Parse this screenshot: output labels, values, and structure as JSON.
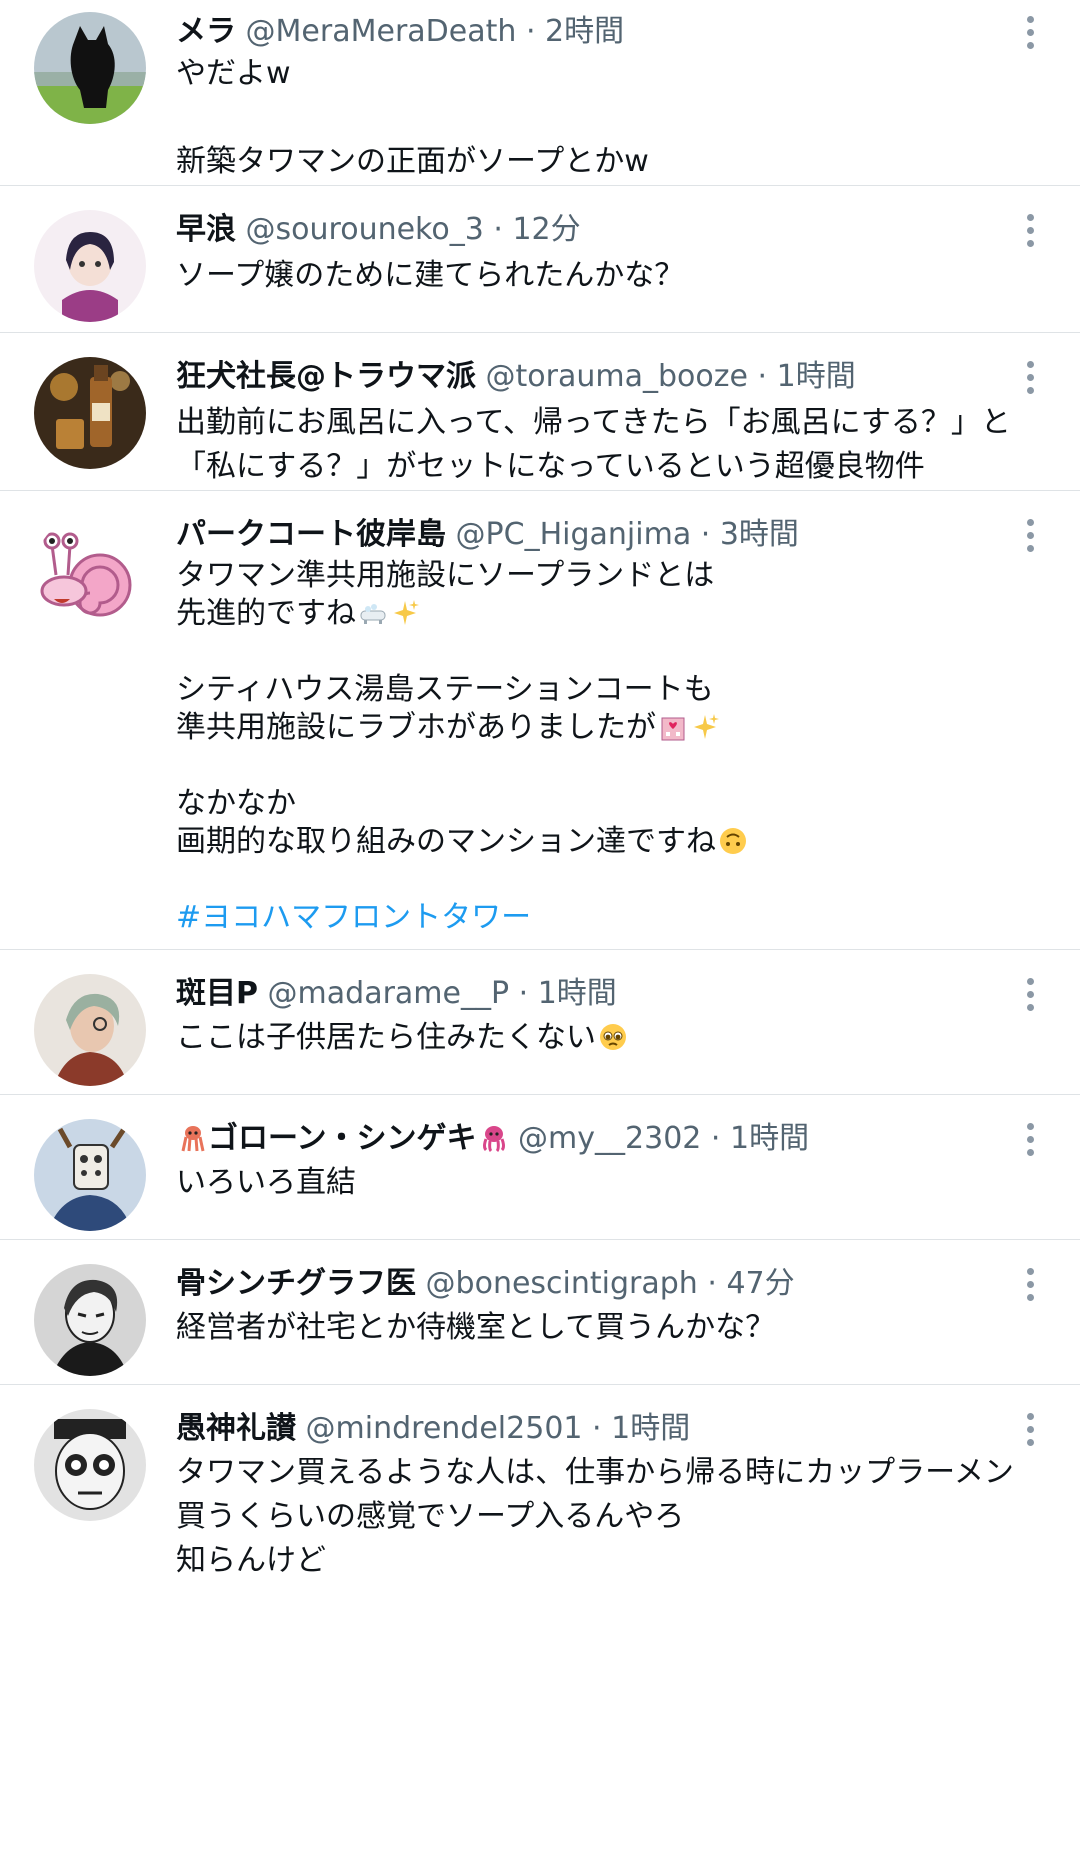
{
  "tweets": [
    {
      "name": "メラ",
      "handle": "@MeraMeraDeath",
      "sep": "·",
      "time": "2時間",
      "lines": [
        "やだよw",
        "",
        "新築タワマンの正面がソープとかw"
      ],
      "avatar_icon": "black-cat-avatar"
    },
    {
      "name": "早浪",
      "handle": "@sourouneko_3",
      "sep": "·",
      "time": "12分",
      "lines": [
        "ソープ嬢のために建てられたんかな？"
      ],
      "avatar_icon": "anime-girl-avatar"
    },
    {
      "name": "狂犬社長@トラウマ派",
      "handle": "@torauma_booze",
      "sep": "·",
      "time": "1時間",
      "lines": [
        "出勤前にお風呂に入って、帰ってきたら「お風呂にする？」と",
        "「私にする？」がセットになっているという超優良物件"
      ],
      "avatar_icon": "whisky-bottle-avatar"
    },
    {
      "name": "パークコート彼岸島",
      "handle": "@PC_Higanjima",
      "sep": "·",
      "time": "3時間",
      "lines": [
        "タワマン準共用施設にソープランドとは",
        "先進的ですね",
        "",
        "シティハウス湯島ステーションコートも",
        "準共用施設にラブホがありましたが",
        "",
        "なかなか",
        "画期的な取り組みのマンション達ですね",
        "",
        "#ヨコハマフロントタワー"
      ],
      "emojis": [
        "bathtub-emoji",
        "sparkles-emoji",
        "love-hotel-emoji",
        "sparkles-emoji",
        "upside-down-face-emoji"
      ],
      "avatar_icon": "pink-snail-avatar"
    },
    {
      "name": "斑目P",
      "handle": "@madarame__P",
      "sep": "·",
      "time": "1時間",
      "lines": [
        "ここは子供居たら住みたくない"
      ],
      "emojis": [
        "pleading-face-emoji"
      ],
      "avatar_icon": "illustrated-man-avatar"
    },
    {
      "name": "ゴローン・シンゲキ",
      "handle": "@my__2302",
      "sep": "·",
      "time": "1時間",
      "lines": [
        "いろいろ直結"
      ],
      "emojis": [
        "squid-emoji",
        "octopus-emoji"
      ],
      "avatar_icon": "masked-figure-avatar"
    },
    {
      "name": "骨シンチグラフ医",
      "handle": "@bonescintigraph",
      "sep": "·",
      "time": "47分",
      "lines": [
        "経営者が社宅とか待機室として買うんかな？"
      ],
      "avatar_icon": "sketched-man-avatar"
    },
    {
      "name": "愚神礼讃",
      "handle": "@mindrendel2501",
      "sep": "·",
      "time": "1時間",
      "lines": [
        "タワマン買えるような人は、仕事から帰る時にカップラーメン",
        "買うくらいの感覚でソープ入るんやろ",
        "知らんけど"
      ],
      "avatar_icon": "goggles-face-avatar"
    }
  ],
  "colors": {
    "text": "#0f1419",
    "secondary": "#536471",
    "hashtag": "#1d9bf0",
    "divider": "#dfe3e6"
  }
}
